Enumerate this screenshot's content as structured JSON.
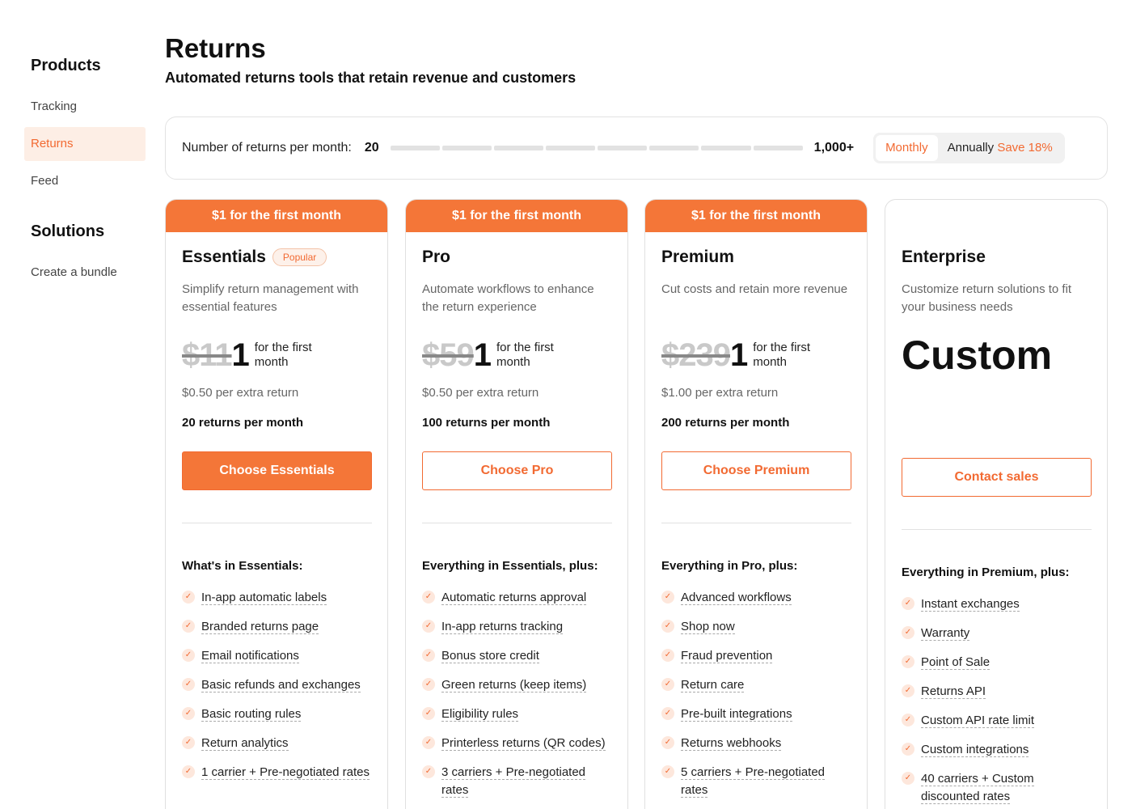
{
  "sidebar": {
    "products_heading": "Products",
    "products_items": [
      {
        "label": "Tracking"
      },
      {
        "label": "Returns"
      },
      {
        "label": "Feed"
      }
    ],
    "solutions_heading": "Solutions",
    "solutions_items": [
      {
        "label": "Create a bundle"
      }
    ]
  },
  "header": {
    "title": "Returns",
    "subtitle": "Automated returns tools that retain revenue and customers"
  },
  "slider": {
    "label": "Number of returns per month:",
    "current_value": "20",
    "max_label": "1,000+",
    "segments": 8,
    "position_fraction": 0
  },
  "billing": {
    "monthly": "Monthly",
    "annually": "Annually",
    "save": "Save 18%",
    "selected": "Monthly"
  },
  "colors": {
    "accent": "#f47638",
    "accent_text": "#f26a32",
    "active_bg": "#fdeee5"
  },
  "plans": [
    {
      "banner": "$1 for the first month",
      "name": "Essentials",
      "badge": "Popular",
      "description": "Simplify return management with essential features",
      "old_price": "$11",
      "new_price": "1",
      "price_note": "for the first month",
      "extra": "$0.50 per extra return",
      "returns": "20 returns per month",
      "cta": "Choose Essentials",
      "features_heading": "What's in Essentials:",
      "features": [
        "In-app automatic labels",
        "Branded returns page",
        "Email notifications",
        "Basic refunds and exchanges",
        "Basic routing rules",
        "Return analytics",
        "1 carrier + Pre-negotiated rates"
      ]
    },
    {
      "banner": "$1 for the first month",
      "name": "Pro",
      "description": "Automate workflows to enhance the return experience",
      "old_price": "$59",
      "new_price": "1",
      "price_note": "for the first month",
      "extra": "$0.50 per extra return",
      "returns": "100 returns per month",
      "cta": "Choose Pro",
      "features_heading": "Everything in Essentials, plus:",
      "features": [
        "Automatic returns approval",
        "In-app returns tracking",
        "Bonus store credit",
        "Green returns (keep items)",
        "Eligibility rules",
        "Printerless returns (QR codes)",
        "3 carriers + Pre-negotiated rates"
      ]
    },
    {
      "banner": "$1 for the first month",
      "name": "Premium",
      "description": "Cut costs and retain more revenue",
      "old_price": "$239",
      "new_price": "1",
      "price_note": "for the first month",
      "extra": "$1.00 per extra return",
      "returns": "200 returns per month",
      "cta": "Choose Premium",
      "features_heading": "Everything in Pro, plus:",
      "features": [
        "Advanced workflows",
        "Shop now",
        "Fraud prevention",
        "Return care",
        "Pre-built integrations",
        "Returns webhooks",
        "5 carriers + Pre-negotiated rates"
      ]
    },
    {
      "name": "Enterprise",
      "description": "Customize return solutions to fit your business needs",
      "custom_price": "Custom",
      "cta": "Contact sales",
      "features_heading": "Everything in Premium, plus:",
      "features": [
        "Instant exchanges",
        "Warranty",
        "Point of Sale",
        "Returns API",
        "Custom API rate limit",
        "Custom integrations",
        "40 carriers + Custom discounted rates"
      ]
    }
  ]
}
